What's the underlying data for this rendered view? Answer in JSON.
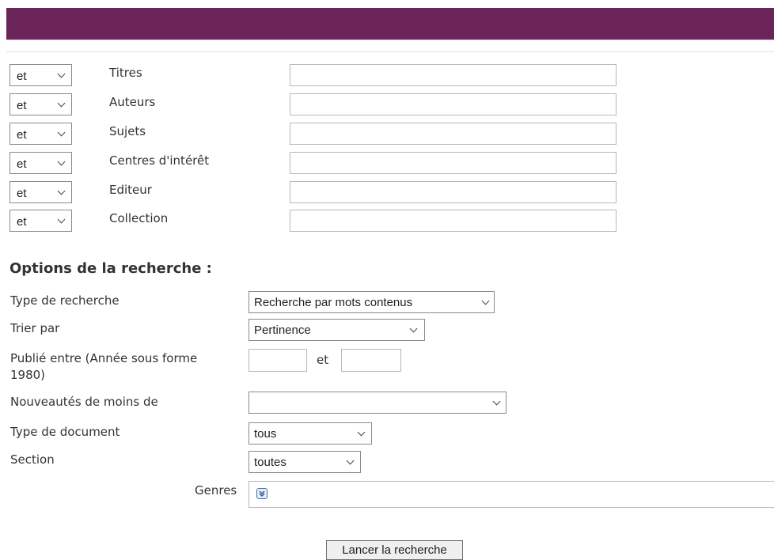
{
  "criteria": [
    {
      "operator": "et",
      "label": "Titres",
      "value": ""
    },
    {
      "operator": "et",
      "label": "Auteurs",
      "value": ""
    },
    {
      "operator": "et",
      "label": "Sujets",
      "value": ""
    },
    {
      "operator": "et",
      "label": "Centres d'intérêt",
      "value": ""
    },
    {
      "operator": "et",
      "label": "Editeur",
      "value": ""
    },
    {
      "operator": "et",
      "label": "Collection",
      "value": ""
    }
  ],
  "options": {
    "title": "Options de la recherche :",
    "search_type": {
      "label": "Type de recherche",
      "selected": "Recherche par mots contenus"
    },
    "sort_by": {
      "label": "Trier par",
      "selected": "Pertinence"
    },
    "published": {
      "label_line1": "Publié entre (Année sous forme",
      "label_line2": "1980)",
      "and_label": "et",
      "from": "",
      "to": ""
    },
    "new_items": {
      "label": "Nouveautés de moins de",
      "selected": ""
    },
    "doc_type": {
      "label": "Type de document",
      "selected": "tous"
    },
    "section": {
      "label": "Section",
      "selected": "toutes"
    },
    "genres": {
      "label": "Genres"
    }
  },
  "submit_label": "Lancer la recherche",
  "colors": {
    "header": "#6b2458"
  }
}
